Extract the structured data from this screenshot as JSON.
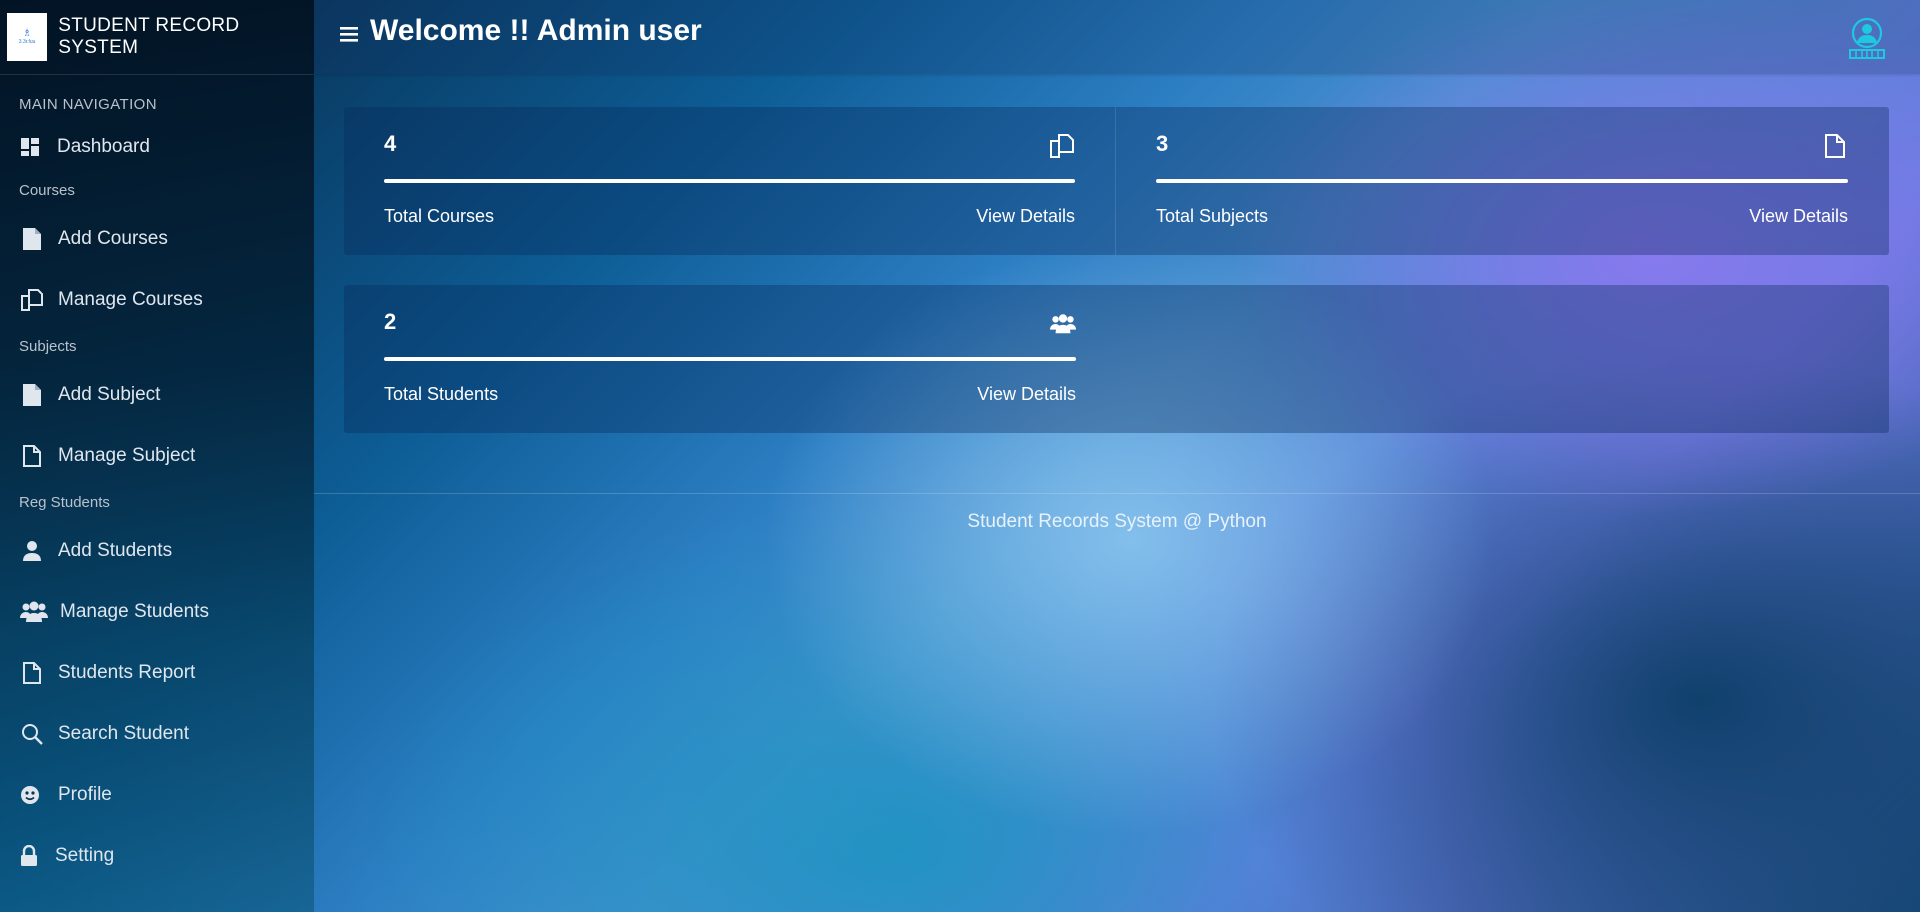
{
  "brand": {
    "title": "STUDENT RECORD SYSTEM",
    "logo_glyph": "♗",
    "logo_text": "3.3r.fuu"
  },
  "header": {
    "title": "Welcome !! Admin user"
  },
  "sidebar": {
    "main_heading": "MAIN NAVIGATION",
    "dashboard": "Dashboard",
    "courses_heading": "Courses",
    "add_courses": "Add Courses",
    "manage_courses": "Manage Courses",
    "subjects_heading": "Subjects",
    "add_subject": "Add Subject",
    "manage_subject": "Manage Subject",
    "students_heading": "Reg Students",
    "add_students": "Add Students",
    "manage_students": "Manage Students",
    "students_report": "Students Report",
    "search_student": "Search Student",
    "profile": "Profile",
    "setting": "Setting"
  },
  "cards": {
    "courses": {
      "count": "4",
      "label": "Total Courses",
      "link": "View Details",
      "icon": "copy-icon"
    },
    "subjects": {
      "count": "3",
      "label": "Total Subjects",
      "link": "View Details",
      "icon": "file-icon"
    },
    "students": {
      "count": "2",
      "label": "Total Students",
      "link": "View Details",
      "icon": "users-icon"
    }
  },
  "footer": {
    "text": "Student Records System @ Python"
  },
  "colors": {
    "accent": "#ffffff",
    "avatar": "#1ec8e0"
  }
}
